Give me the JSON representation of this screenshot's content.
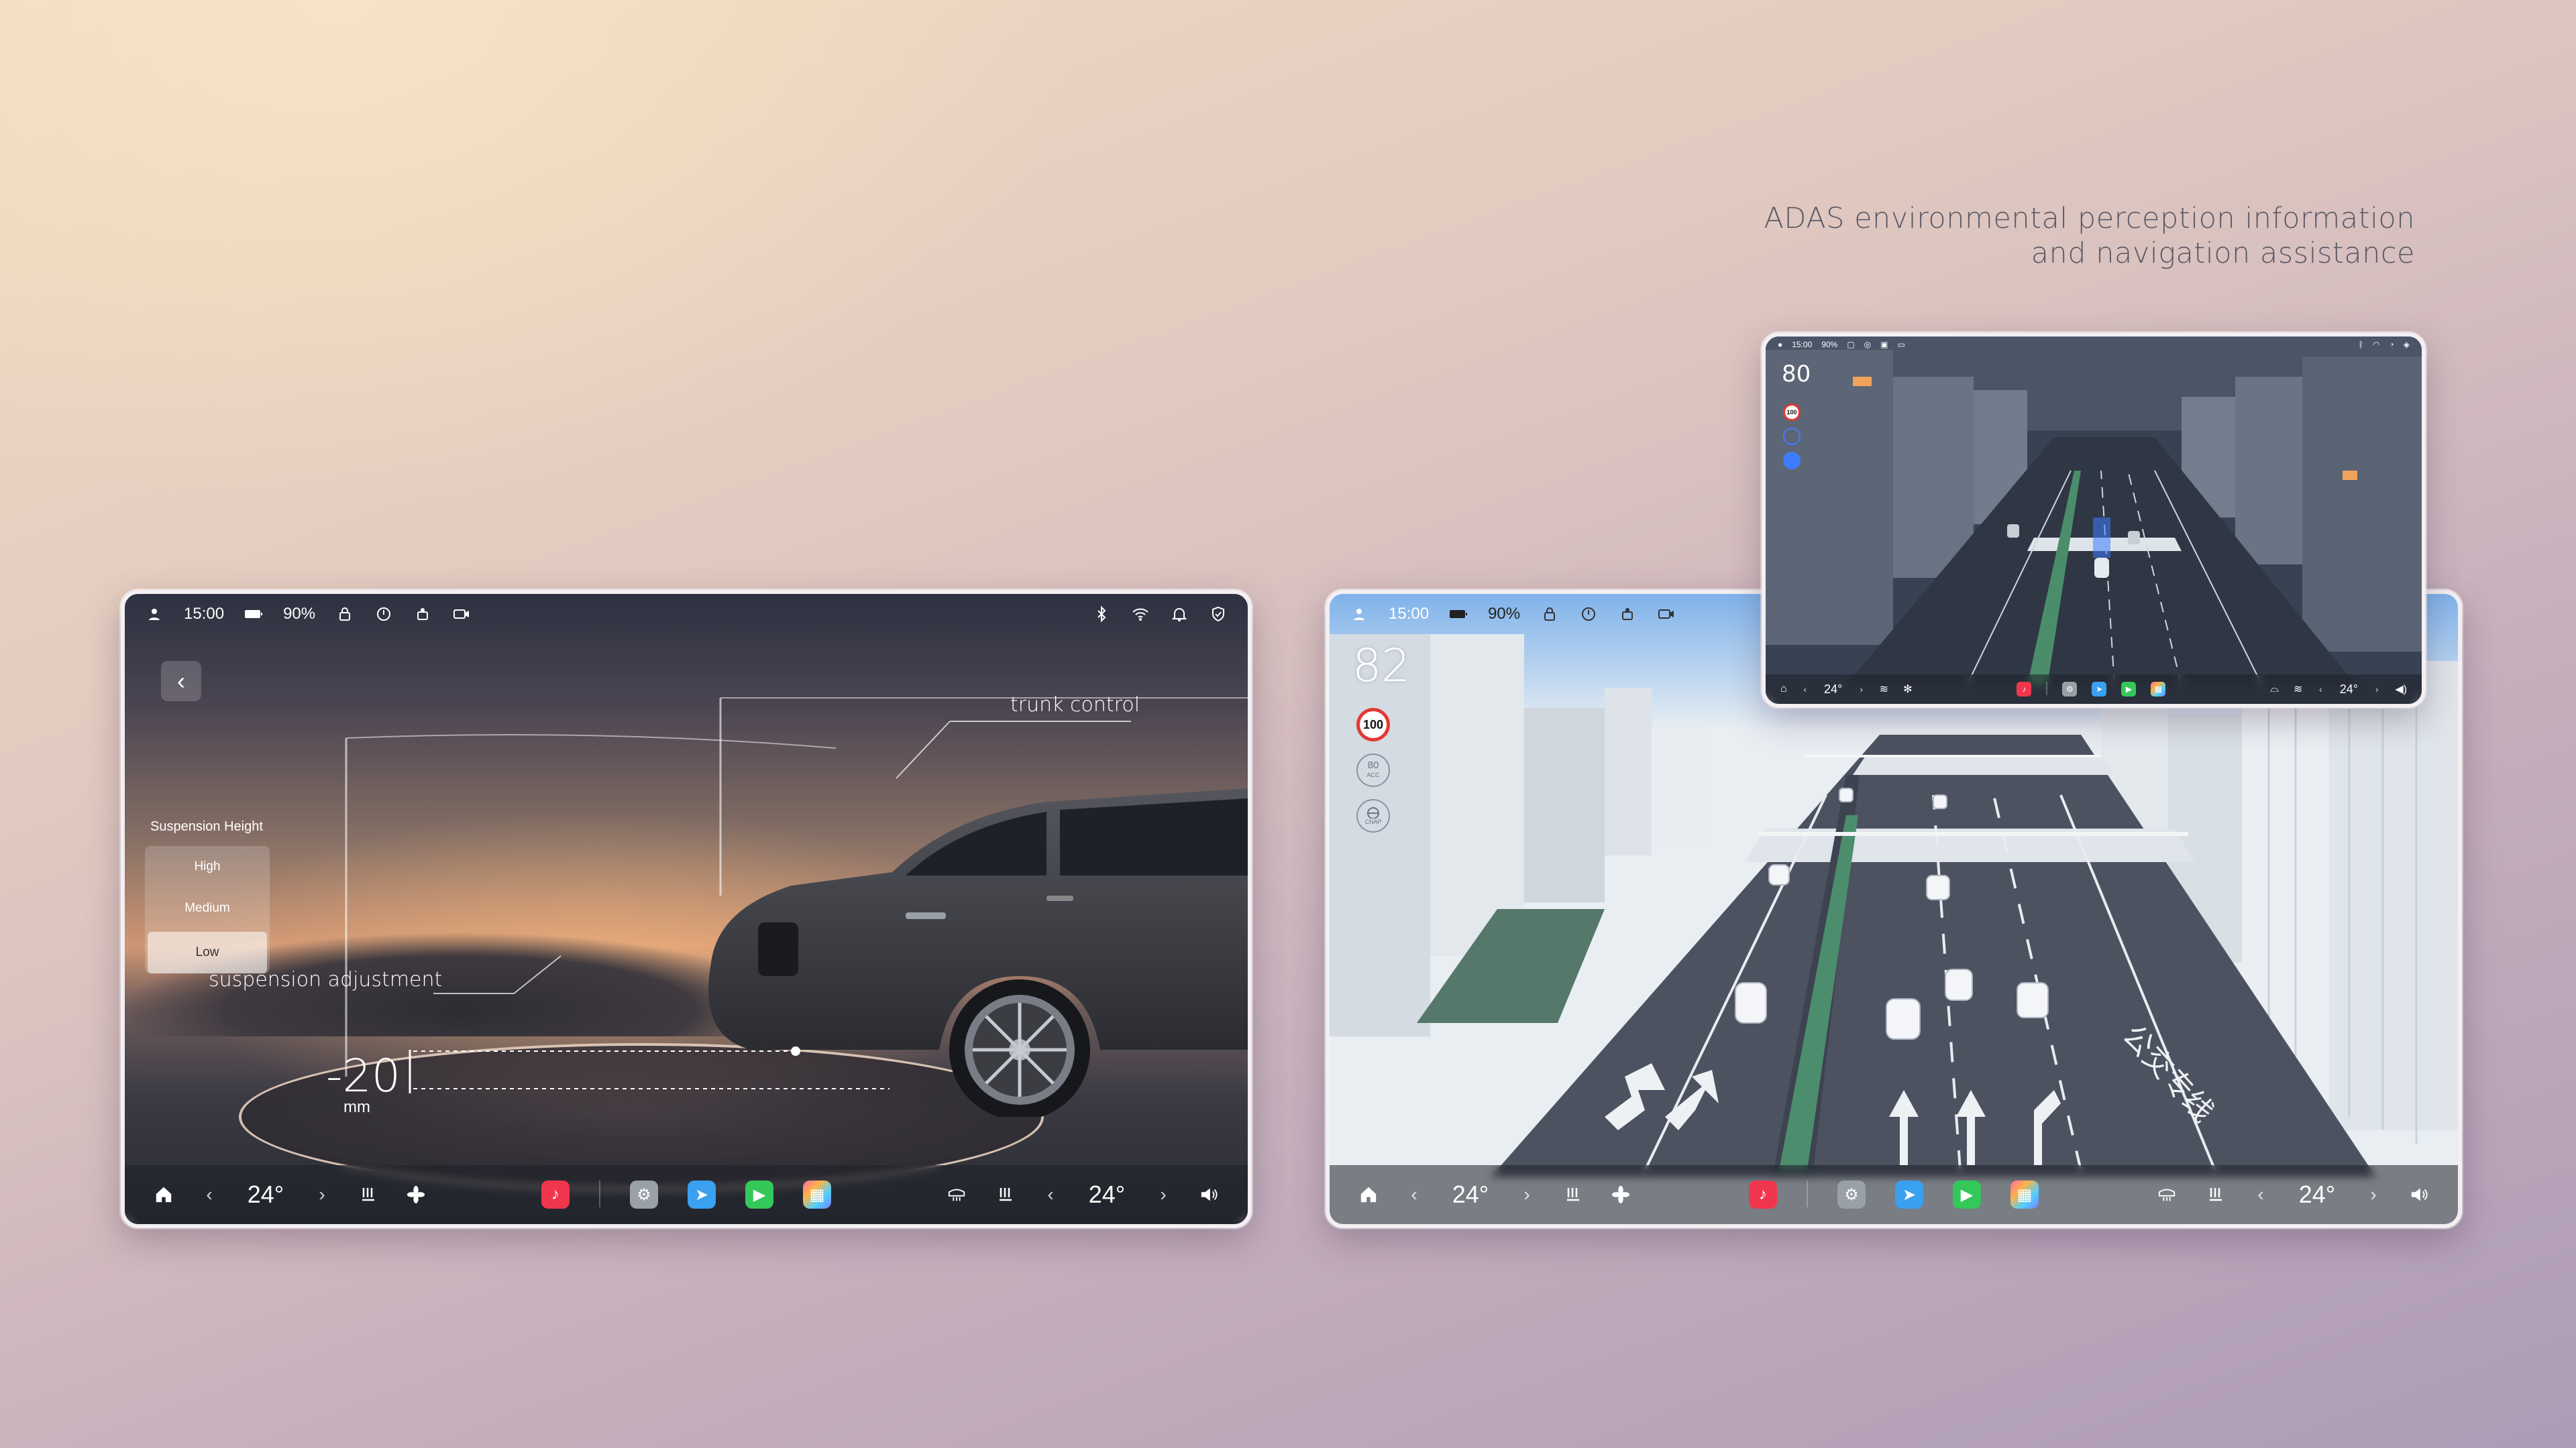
{
  "headline": {
    "line1": "ADAS environmental perception information",
    "line2": "and navigation assistance"
  },
  "status_bar": {
    "time": "15:00",
    "battery": "90%"
  },
  "suspension": {
    "title": "Suspension Height",
    "options": [
      "High",
      "Medium",
      "Low"
    ],
    "selected": "Low",
    "value": "-20",
    "unit": "mm"
  },
  "callouts": {
    "trunk": "trunk control",
    "suspension": "suspension adjustment"
  },
  "dock": {
    "left_temp": "24°",
    "right_temp": "24°"
  },
  "adas": {
    "speed_main": "82",
    "speed_small": "80",
    "speed_limit": "100",
    "acc_set": "80",
    "acc_label": "ACC",
    "noa_label": "CNAP",
    "road_marking": "公交专线"
  },
  "colors": {
    "music": "#f0364d",
    "settings": "#9aa0a8",
    "maps": "#3aa0f0",
    "facetime": "#34c759",
    "apps_grid": "#ff6aa3"
  }
}
